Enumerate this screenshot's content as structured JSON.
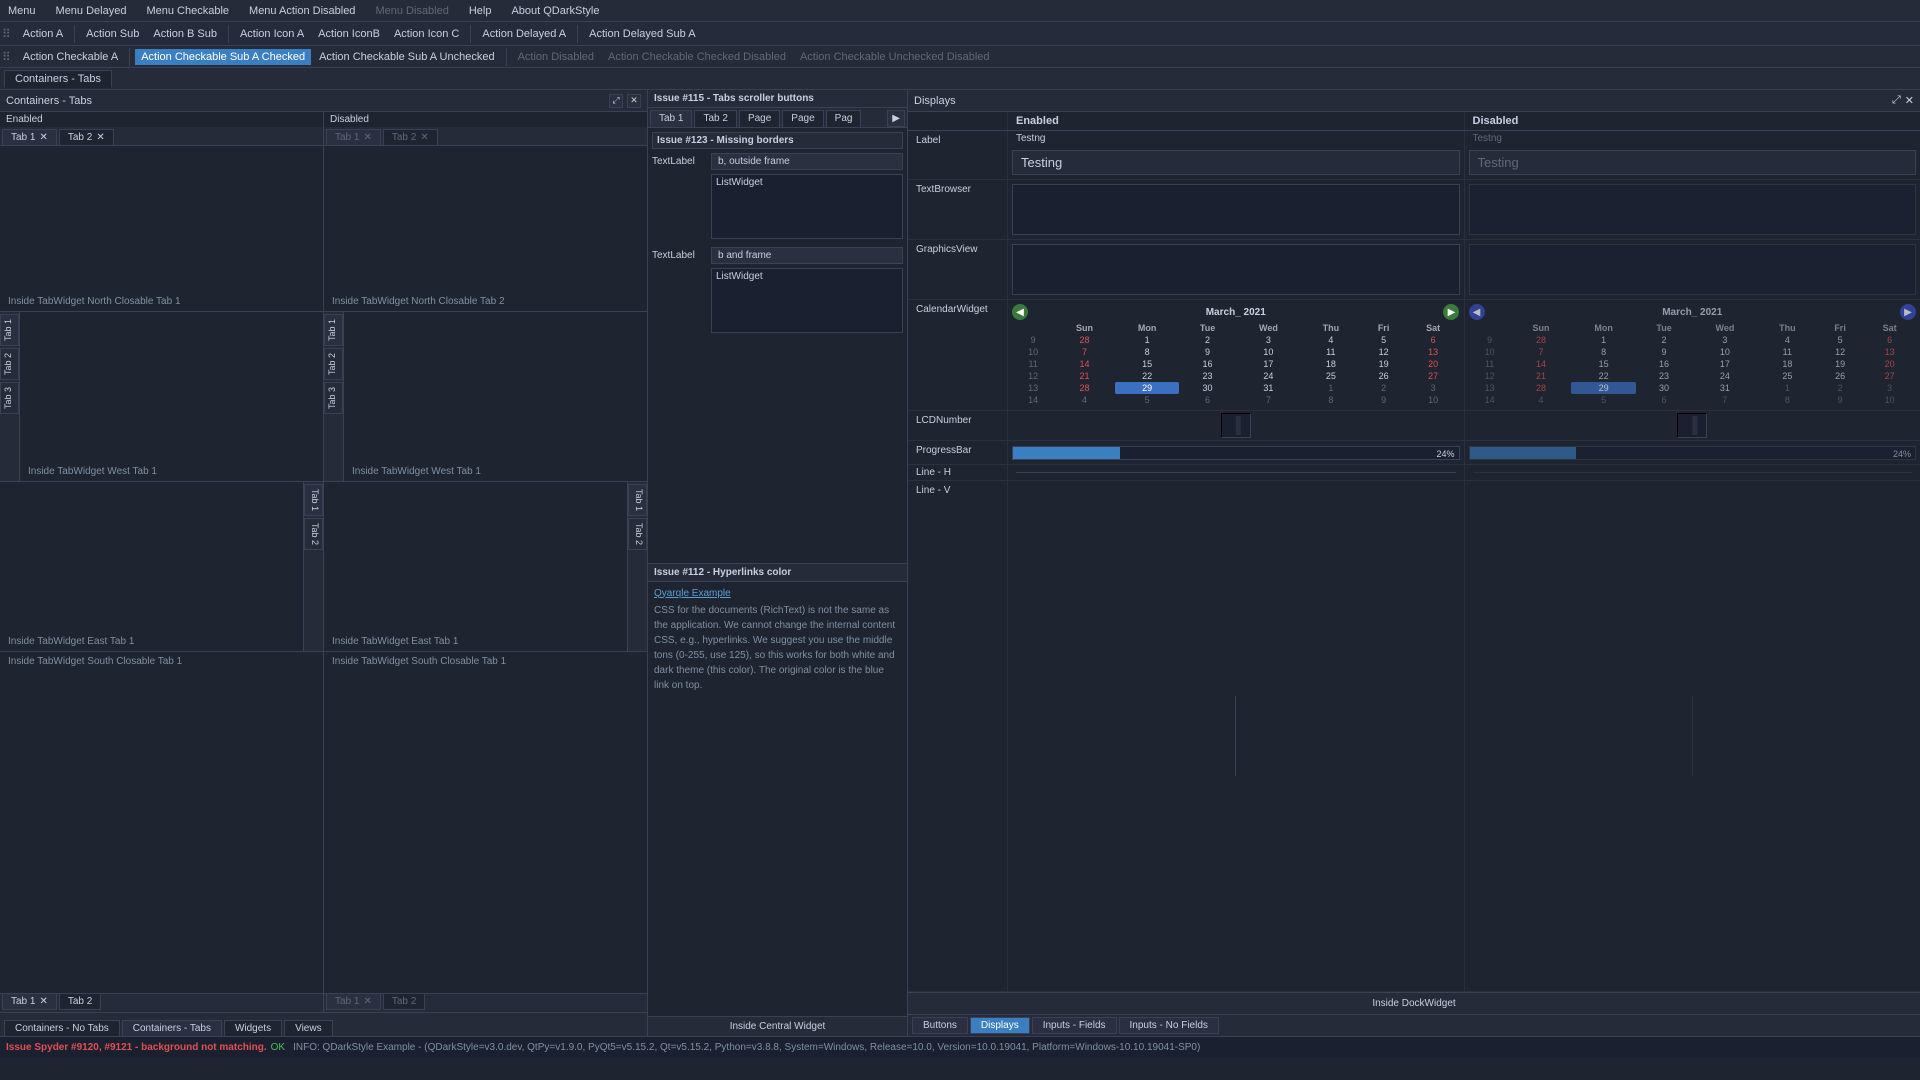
{
  "menubar": {
    "items": [
      "Menu",
      "Menu Delayed",
      "Menu Checkable",
      "Menu Action Disabled",
      "Menu Disabled",
      "Help",
      "About QDarkStyle"
    ]
  },
  "toolbar1": {
    "actions": [
      {
        "label": "Action A",
        "id": "action-a"
      },
      {
        "label": "Action Sub",
        "id": "action-sub-1"
      },
      {
        "label": "Action B Sub",
        "id": "action-b-sub"
      },
      {
        "label": "Action Icon A",
        "id": "action-icon-a"
      },
      {
        "label": "Action IconB",
        "id": "action-icon-b"
      },
      {
        "label": "Action Icon C",
        "id": "action-icon-c"
      },
      {
        "label": "Action Delayed A",
        "id": "action-delayed-a"
      },
      {
        "label": "Action Delayed Sub A",
        "id": "action-delayed-sub-a"
      }
    ]
  },
  "toolbar2": {
    "actions": [
      {
        "label": "Action Checkable A",
        "id": "action-checkable-a",
        "checked": false
      },
      {
        "label": "Action Checkable Sub A Checked",
        "id": "action-checkable-sub-checked",
        "checked": true
      },
      {
        "label": "Action Checkable Sub A Unchecked",
        "id": "action-checkable-sub-unchecked",
        "checked": false
      },
      {
        "label": "Action Disabled",
        "id": "action-disabled",
        "disabled": true
      },
      {
        "label": "Action Checkable Checked Disabled",
        "id": "action-checkable-checked-disabled"
      },
      {
        "label": "Action Checkable Unchecked Disabled",
        "id": "action-checkable-unchecked-disabled"
      }
    ]
  },
  "left_panel": {
    "title": "Containers - Tabs",
    "enabled_label": "Enabled",
    "disabled_label": "Disabled",
    "north_tabs_enabled": [
      {
        "label": "Tab 1",
        "closable": true,
        "active": true
      },
      {
        "label": "Tab 2",
        "closable": true
      }
    ],
    "north_tabs_disabled": [
      {
        "label": "Tab 1",
        "closable": true,
        "active": true
      },
      {
        "label": "Tab 2",
        "closable": true
      }
    ],
    "north_content_enabled": "Inside TabWidget North Closable Tab 1",
    "north_content_disabled": "Inside TabWidget North Closable Tab 2",
    "west_tabs_enabled": [
      {
        "label": "Tab 1",
        "active": true
      },
      {
        "label": "Tab 2"
      },
      {
        "label": "Tab 3"
      }
    ],
    "west_content_enabled": "Inside TabWidget West Tab 1",
    "west_content_disabled": "Inside TabWidget West Tab 1",
    "east_tabs_enabled": [
      {
        "label": "Tab 1",
        "active": true
      },
      {
        "label": "Tab 2"
      }
    ],
    "east_content_enabled": "Inside TabWidget East Tab 1",
    "east_content_disabled": "Inside TabWidget East Tab 1",
    "south_content_enabled": "Inside TabWidget South Closable Tab 1",
    "south_content_disabled": "Inside TabWidget South Closable Tab 1",
    "south_tabs_enabled": [
      {
        "label": "Tab 1",
        "closable": true,
        "active": true
      },
      {
        "label": "Tab 2",
        "closable": false
      }
    ],
    "south_tabs_disabled": [
      {
        "label": "Tab 1",
        "closable": true,
        "active": true
      },
      {
        "label": "Tab 2",
        "closable": false
      }
    ],
    "bottom_tabs": [
      "Containers - No Tabs",
      "Containers - Tabs",
      "Widgets",
      "Views"
    ]
  },
  "center_panel": {
    "issue_115": {
      "title": "Issue #115 - Tabs scroller buttons",
      "tabs": [
        "Tab 1",
        "Tab 2",
        "Page",
        "Page",
        "Pag"
      ],
      "issue_123": {
        "title": "Issue #123 - Missing borders",
        "text_label_value": "b, outside frame",
        "list_widget_label": "ListWidget",
        "text_label_2_value": "b and frame",
        "list_widget_2_label": "ListWidget"
      }
    },
    "issue_112": {
      "title": "Issue #112 - Hyperlinks color",
      "hyperlink_text": "Qyarqle Example",
      "body_text": "CSS for the documents (RichText) is not the same as the application. We cannot change the internal content CSS, e.g., hyperlinks. We suggest you use the middle tons (0-255, use 125), so this works for both white and dark theme (this color). The original color is the blue link on top."
    },
    "central_widget_label": "Inside Central Widget"
  },
  "right_panel": {
    "title": "Displays",
    "enabled_header": "Enabled",
    "disabled_header": "Disabled",
    "rows": {
      "label": {
        "name": "Label",
        "enabled_small": "Testng",
        "enabled_large": "Testing",
        "disabled_small": "Testng",
        "disabled_large": "Testing"
      },
      "text_browser": {
        "name": "TextBrowser"
      },
      "graphics_view": {
        "name": "GraphicsView"
      },
      "calendar": {
        "name": "CalendarWidget",
        "enabled": {
          "month": "March_",
          "year": "2021",
          "days": [
            "Sun",
            "Mon",
            "Tue",
            "Wed",
            "Thu",
            "Fri",
            "Sat"
          ],
          "weeks": [
            [
              9,
              28,
              1,
              2,
              3,
              4,
              5,
              6
            ],
            [
              10,
              7,
              8,
              9,
              10,
              11,
              12,
              13
            ],
            [
              11,
              14,
              15,
              16,
              17,
              18,
              19,
              20
            ],
            [
              12,
              21,
              22,
              23,
              24,
              25,
              26,
              27
            ],
            [
              13,
              28,
              29,
              30,
              31,
              1,
              2,
              3
            ],
            [
              14,
              4,
              5,
              6,
              7,
              8,
              9,
              10
            ]
          ],
          "today": 29
        },
        "disabled": {
          "month": "March_",
          "year": "2021",
          "days": [
            "Sun",
            "Mon",
            "Tue",
            "Wed",
            "Thu",
            "Fri",
            "Sat"
          ],
          "weeks": [
            [
              9,
              28,
              1,
              2,
              3,
              4,
              5,
              6
            ],
            [
              10,
              7,
              8,
              9,
              10,
              11,
              12,
              13
            ],
            [
              11,
              14,
              15,
              16,
              17,
              18,
              19,
              20
            ],
            [
              12,
              21,
              22,
              23,
              24,
              25,
              26,
              27
            ],
            [
              13,
              28,
              29,
              30,
              31,
              1,
              2,
              3
            ],
            [
              14,
              4,
              5,
              6,
              7,
              8,
              9,
              10
            ]
          ],
          "today": 29
        }
      },
      "lcd": {
        "name": "LCDNumber"
      },
      "progress_bar": {
        "name": "ProgressBar",
        "enabled_value": 24,
        "disabled_value": 24,
        "label": "24%"
      },
      "line_h": {
        "name": "Line - H"
      },
      "line_v": {
        "name": "Line - V"
      }
    },
    "dock_widget_label": "Inside DockWidget",
    "nav_buttons": [
      "Buttons",
      "Displays",
      "Inputs - Fields",
      "Inputs - No Fields"
    ]
  },
  "status_bar": {
    "label": "Issue Spyder #9120, #9121 - background not matching.",
    "ok": "OK",
    "info": "INFO: QDarkStyle Example - (QDarkStyle=v3.0.dev, QtPy=v1.9.0, PyQt5=v5.15.2, Qt=v5.15.2, Python=v3.8.8, System=Windows, Release=10.0, Version=10.0.19041, Platform=Windows-10.10.19041-SP0)"
  }
}
